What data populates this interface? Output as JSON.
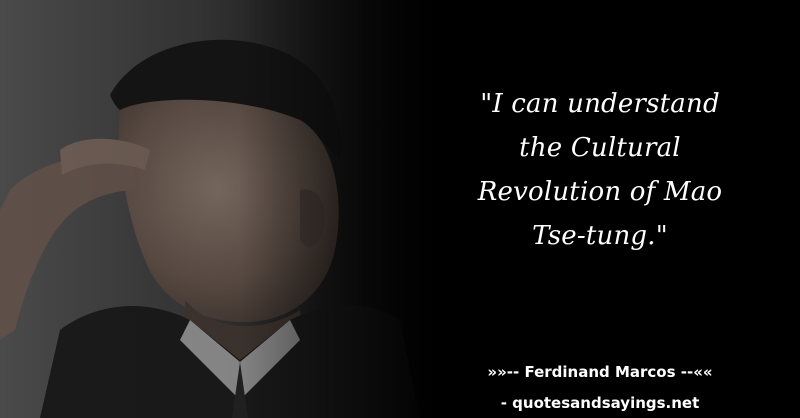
{
  "quote": {
    "lines": [
      "\"I can understand",
      "the Cultural",
      "Revolution of Mao",
      "Tse-tung.\""
    ]
  },
  "attribution": "»»-- Ferdinand Marcos --««",
  "source": "- quotesandsayings.net",
  "colors": {
    "background": "#000000",
    "text": "#ffffff"
  }
}
